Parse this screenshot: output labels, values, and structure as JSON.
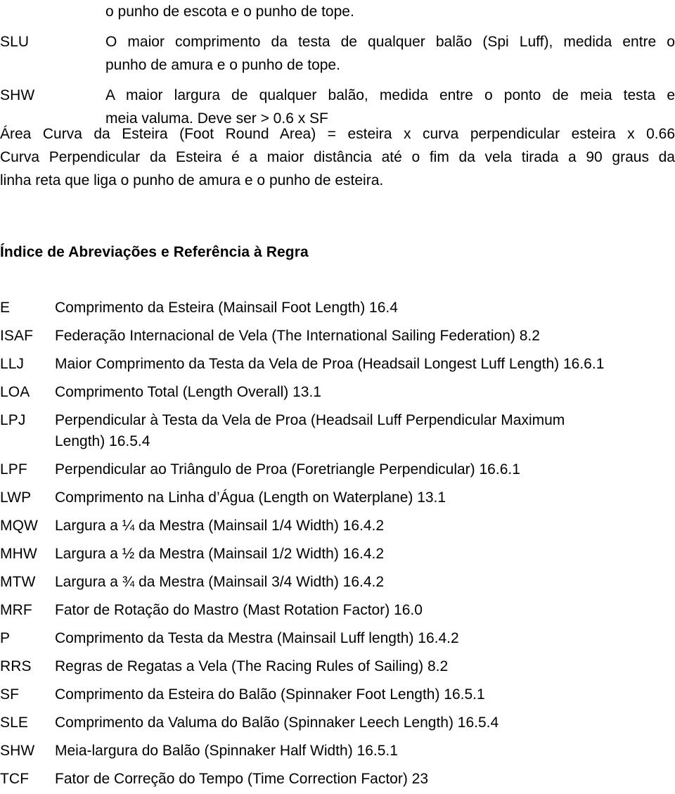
{
  "document": {
    "language": "pt-BR",
    "background_color": "#ffffff",
    "text_color": "#000000"
  },
  "top_definitions": {
    "orphan_line": "o punho de escota e o punho de tope.",
    "entries": [
      {
        "term": "SLU",
        "line1": "O maior comprimento da testa de qualquer balão (Spi Luff), medida entre o",
        "line2": "punho de amura e o punho de tope."
      },
      {
        "term": "SHW",
        "line1": "A maior largura de qualquer balão, medida entre o ponto de meia testa e",
        "line2": "meia valuma. Deve ser > 0.6 x SF"
      }
    ]
  },
  "foot_round_paragraph": {
    "line1": "Área Curva da Esteira (Foot Round Area) = esteira x curva perpendicular esteira x 0.66",
    "line2": "Curva Perpendicular da Esteira é a maior distância até o fim da vela tirada a 90 graus da",
    "line3": "linha reta que liga o punho de amura e o punho de esteira."
  },
  "glossary": {
    "heading": "Índice de Abreviações e Referência à Regra",
    "entries": [
      {
        "term": "E",
        "definition": "Comprimento da Esteira (Mainsail Foot Length) 16.4"
      },
      {
        "term": "ISAF",
        "definition": "Federação Internacional de Vela (The International Sailing Federation) 8.2"
      },
      {
        "term": "LLJ",
        "definition": "Maior Comprimento da Testa da Vela de Proa (Headsail Longest Luff Length) 16.6.1"
      },
      {
        "term": "LOA",
        "definition": "Comprimento Total (Length Overall) 13.1"
      },
      {
        "term": "LPJ",
        "definition": "Perpendicular à Testa da Vela de Proa (Headsail Luff Perpendicular Maximum",
        "definition_line2": "Length) 16.5.4"
      },
      {
        "term": "LPF",
        "definition": "Perpendicular ao Triângulo de Proa (Foretriangle Perpendicular) 16.6.1"
      },
      {
        "term": "LWP",
        "definition": "Comprimento na Linha d’Água (Length on Waterplane) 13.1"
      },
      {
        "term": "MQW",
        "definition": "Largura a ¼ da Mestra (Mainsail 1/4 Width) 16.4.2"
      },
      {
        "term": "MHW",
        "definition": "Largura a ½ da Mestra (Mainsail 1/2 Width) 16.4.2"
      },
      {
        "term": "MTW",
        "definition": "Largura a ¾ da Mestra (Mainsail 3/4 Width) 16.4.2"
      },
      {
        "term": "MRF",
        "definition": "Fator de Rotação do Mastro (Mast Rotation Factor) 16.0"
      },
      {
        "term": "P",
        "definition": "Comprimento da Testa da Mestra (Mainsail Luff length) 16.4.2"
      },
      {
        "term": "RRS",
        "definition": "Regras de Regatas a Vela (The Racing Rules of Sailing) 8.2"
      },
      {
        "term": "SF",
        "definition": "Comprimento da Esteira do Balão (Spinnaker Foot Length) 16.5.1"
      },
      {
        "term": "SLE",
        "definition": "Comprimento da Valuma do Balão (Spinnaker Leech Length) 16.5.4"
      },
      {
        "term": "SHW",
        "definition": "Meia-largura do Balão (Spinnaker Half Width) 16.5.1"
      },
      {
        "term": "TCF",
        "definition": "Fator de Correção do Tempo (Time Correction Factor) 23"
      }
    ]
  }
}
